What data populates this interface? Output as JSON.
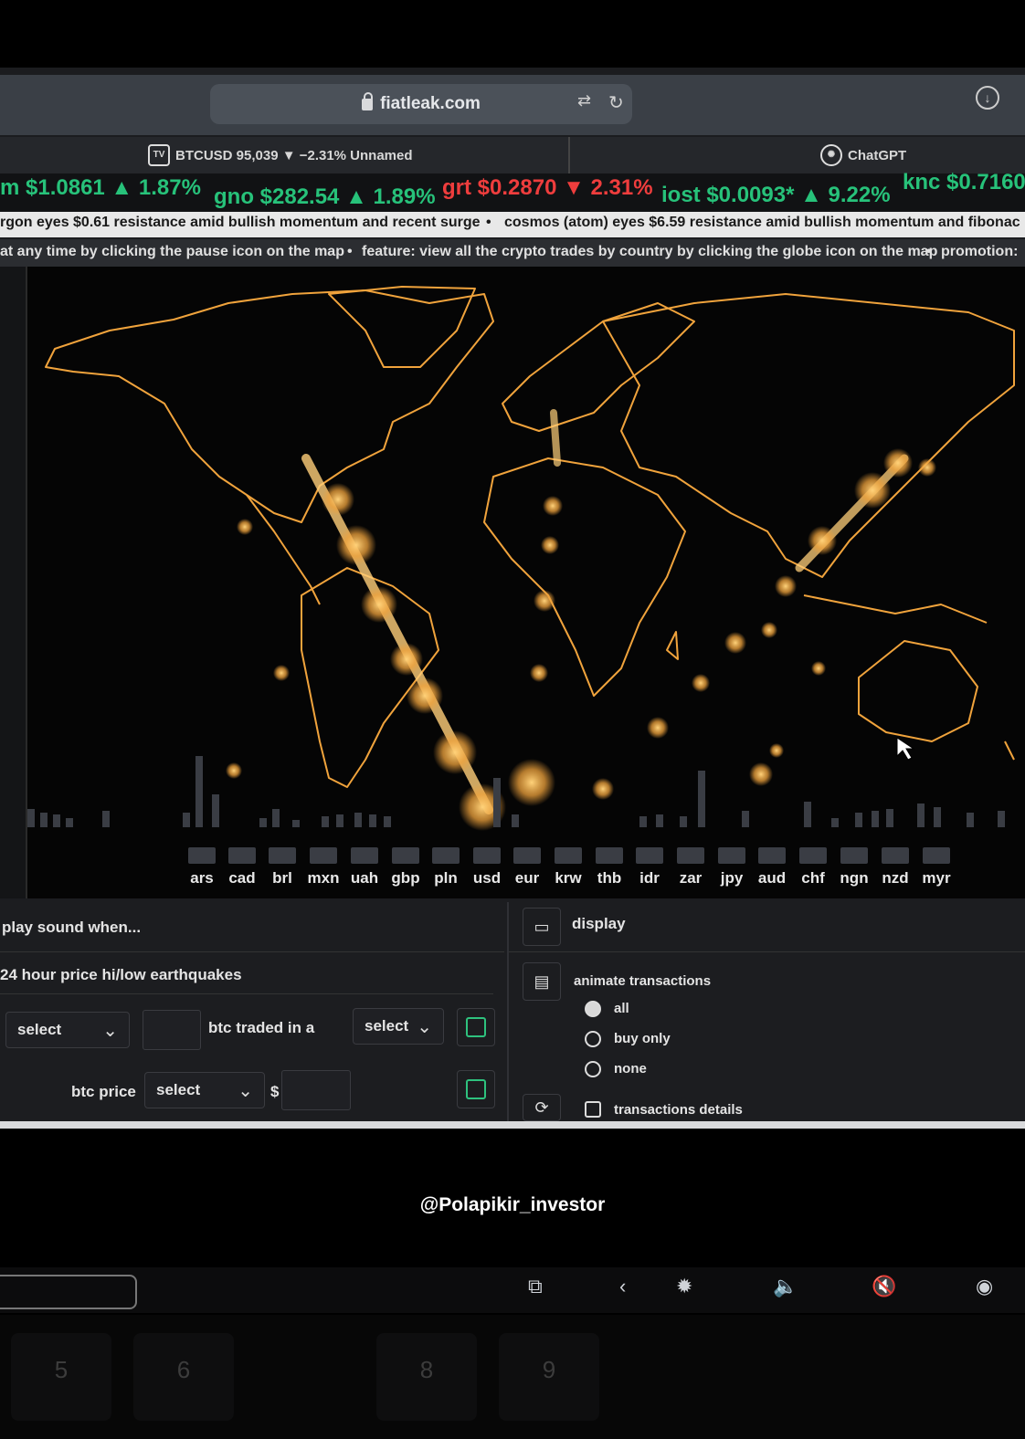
{
  "browser": {
    "url": "fiatleak.com",
    "tabs": [
      {
        "label": "BTCUSD 95,039 ▼ −2.31% Unnamed",
        "favicon": "TV"
      },
      {
        "label": "ChatGPT",
        "favicon": "openai-icon"
      }
    ]
  },
  "ticker": [
    {
      "text": "m $1.0861 ▲ 1.87%",
      "dir": "up"
    },
    {
      "text": "gno $282.54 ▲ 1.89%",
      "dir": "up"
    },
    {
      "text": "grt $0.2870 ▼ 2.31%",
      "dir": "down"
    },
    {
      "text": "iost $0.0093* ▲ 9.22%",
      "dir": "up"
    },
    {
      "text": "knc $0.7160",
      "dir": "up"
    }
  ],
  "news": {
    "item1": "rgon eyes $0.61 resistance amid bullish momentum and recent surge",
    "sep": "•",
    "item2": "cosmos (atom) eyes $6.59 resistance amid bullish momentum and fibonac"
  },
  "promo": {
    "item1": "at any time by clicking the pause icon on the map",
    "sep": "•",
    "item2": "feature: view all the crypto trades by country by clicking the globe icon on the map",
    "sep2": "•",
    "item3": "promotion:"
  },
  "currencies": [
    "ars",
    "cad",
    "brl",
    "mxn",
    "uah",
    "gbp",
    "pln",
    "usd",
    "eur",
    "krw",
    "thb",
    "idr",
    "zar",
    "jpy",
    "aud",
    "chf",
    "ngn",
    "nzd",
    "myr"
  ],
  "sound": {
    "header": "play sound when...",
    "section_title": "24 hour price hi/low earthquakes",
    "row1": {
      "select1": "select",
      "mid_label": "btc traded in a",
      "select2": "select"
    },
    "row2": {
      "label": "btc price",
      "select": "select",
      "currency_symbol": "$"
    }
  },
  "display": {
    "header": "display",
    "animate_label": "animate transactions",
    "options": [
      {
        "label": "all",
        "checked": true
      },
      {
        "label": "buy only",
        "checked": false
      },
      {
        "label": "none",
        "checked": false
      }
    ],
    "details_label": "transactions details"
  },
  "watermark": "@Polapikir_investor",
  "keys": [
    "5",
    "6",
    "8",
    "9"
  ],
  "colors": {
    "accent": "#f0a33c",
    "up": "#27c27a",
    "down": "#ef3d3d"
  }
}
